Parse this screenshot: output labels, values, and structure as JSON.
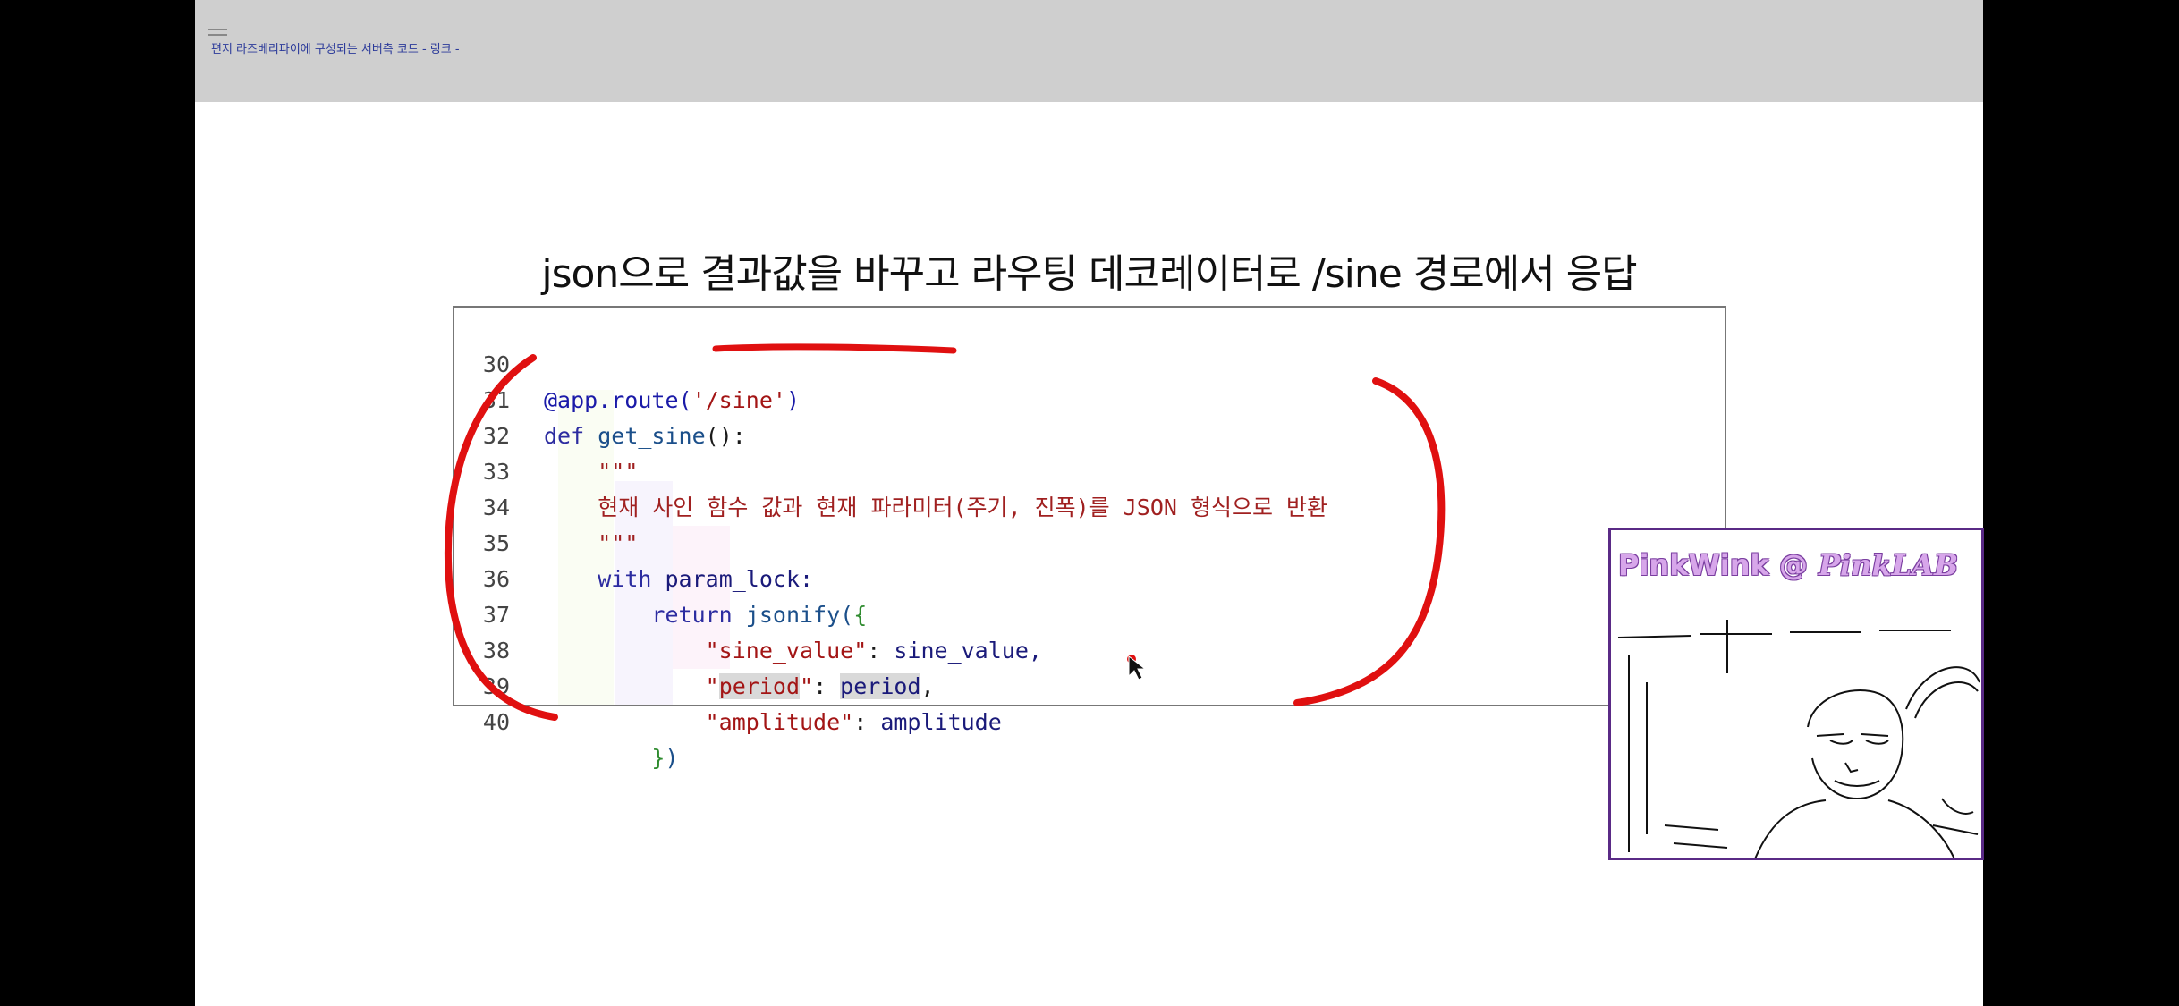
{
  "header": {
    "breadcrumb": "편지 라즈베리파이에 구성되는 서버측 코드 - 링크 -"
  },
  "slide": {
    "title": "json으로 결과값을 바꾸고 라우팅 데코레이터로 /sine 경로에서 응답"
  },
  "code": {
    "line_numbers": [
      "30",
      "31",
      "32",
      "33",
      "34",
      "35",
      "36",
      "37",
      "38",
      "39",
      "40"
    ],
    "decorator": "@app.route(",
    "route_path": "'/sine'",
    "decorator_close": ")",
    "def_keyword": "def",
    "function_name": "get_sine",
    "function_sig": "():",
    "docstring_open": "\"\"\"",
    "docstring_text": "현재 사인 함수 값과 현재 파라미터(주기, 진폭)를 JSON 형식으로 반환",
    "docstring_close": "\"\"\"",
    "with_keyword": "with",
    "lock_name": "param_lock:",
    "return_keyword": "return",
    "jsonify_call": "jsonify(",
    "open_brace": "{",
    "key_sine_value": "\"sine_value\"",
    "val_sine_value": "sine_value,",
    "key_period_q1": "\"",
    "key_period": "period",
    "key_period_q2": "\"",
    "val_period": "period",
    "key_amplitude": "\"amplitude\"",
    "val_amplitude": "amplitude",
    "close_brace": "}",
    "close_paren": ")",
    "colon_sep": ": ",
    "comma": ","
  },
  "webcam": {
    "overlay_name": "PinkWink @",
    "overlay_brand": "PinkLAB"
  },
  "colors": {
    "annotation_red": "#e01010",
    "webcam_border": "#5a2a86"
  }
}
